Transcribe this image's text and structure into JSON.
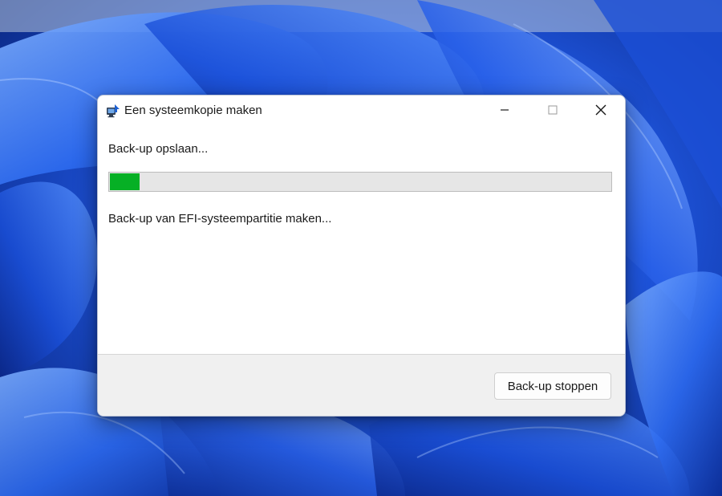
{
  "window": {
    "title": "Een systeemkopie maken",
    "icon": "backup-computer-icon"
  },
  "caption_buttons": {
    "minimize_icon": "minimize-icon",
    "maximize_icon": "maximize-icon",
    "close_icon": "close-icon"
  },
  "main": {
    "status_label": "Back-up opslaan...",
    "detail_label": "Back-up van EFI-systeempartitie maken...",
    "progress_fraction": 0.06,
    "progress_color": "#06b025"
  },
  "footer": {
    "stop_button_label": "Back-up stoppen"
  },
  "colors": {
    "wallpaper_primary": "#1e5fe6",
    "window_background": "#ffffff",
    "footer_background": "#f0f0f0"
  }
}
